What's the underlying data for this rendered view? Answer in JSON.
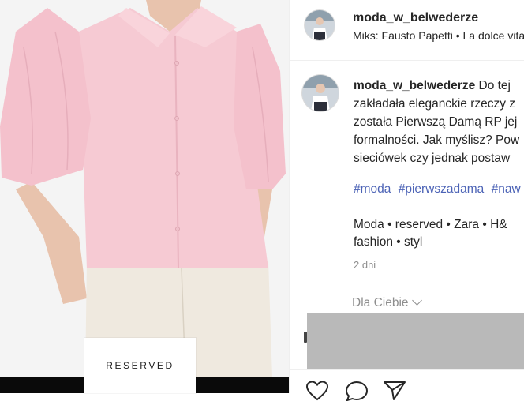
{
  "photo": {
    "brand_label": "RESERVED",
    "colors": {
      "background": "#f4f4f4",
      "shirt": "#f6cad3",
      "trousers": "#efe9df",
      "skin": "#e8c3ad"
    }
  },
  "header": {
    "username": "moda_w_belwederze",
    "audio": "Miks: Fausto Papetti • La dolce vita"
  },
  "caption": {
    "username": "moda_w_belwederze",
    "first_line_text": " Do tej",
    "lines": [
      "zakładała eleganckie rzeczy z",
      "została Pierwszą Damą RP jej",
      "formalności. Jak myślisz? Pow",
      "sieciówek czy jednak postaw"
    ],
    "hashtags": [
      "#moda",
      "#pierwszadama",
      "#naw"
    ],
    "tags_line1": "Moda • reserved • Zara • H&",
    "tags_line2": "fashion • styl",
    "time": "2 dni"
  },
  "for_you": {
    "label": "Dla Ciebie"
  },
  "actions": {
    "icons": [
      "heart-icon",
      "comment-icon",
      "share-icon"
    ]
  },
  "colors": {
    "hashtag": "#4c63b6",
    "text": "#262626",
    "muted": "#8e8e8e"
  }
}
